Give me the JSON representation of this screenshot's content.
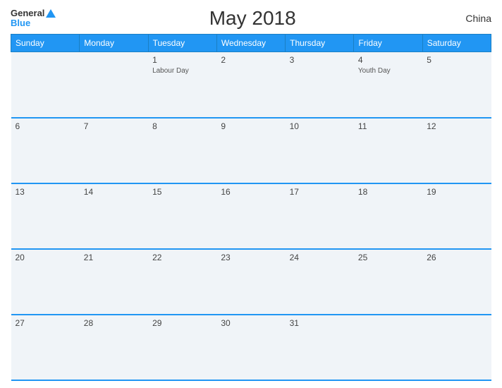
{
  "header": {
    "logo_general": "General",
    "logo_blue": "Blue",
    "title": "May 2018",
    "country": "China"
  },
  "calendar": {
    "days_of_week": [
      "Sunday",
      "Monday",
      "Tuesday",
      "Wednesday",
      "Thursday",
      "Friday",
      "Saturday"
    ],
    "weeks": [
      [
        {
          "day": "",
          "holiday": ""
        },
        {
          "day": "",
          "holiday": ""
        },
        {
          "day": "1",
          "holiday": "Labour Day"
        },
        {
          "day": "2",
          "holiday": ""
        },
        {
          "day": "3",
          "holiday": ""
        },
        {
          "day": "4",
          "holiday": "Youth Day"
        },
        {
          "day": "5",
          "holiday": ""
        }
      ],
      [
        {
          "day": "6",
          "holiday": ""
        },
        {
          "day": "7",
          "holiday": ""
        },
        {
          "day": "8",
          "holiday": ""
        },
        {
          "day": "9",
          "holiday": ""
        },
        {
          "day": "10",
          "holiday": ""
        },
        {
          "day": "11",
          "holiday": ""
        },
        {
          "day": "12",
          "holiday": ""
        }
      ],
      [
        {
          "day": "13",
          "holiday": ""
        },
        {
          "day": "14",
          "holiday": ""
        },
        {
          "day": "15",
          "holiday": ""
        },
        {
          "day": "16",
          "holiday": ""
        },
        {
          "day": "17",
          "holiday": ""
        },
        {
          "day": "18",
          "holiday": ""
        },
        {
          "day": "19",
          "holiday": ""
        }
      ],
      [
        {
          "day": "20",
          "holiday": ""
        },
        {
          "day": "21",
          "holiday": ""
        },
        {
          "day": "22",
          "holiday": ""
        },
        {
          "day": "23",
          "holiday": ""
        },
        {
          "day": "24",
          "holiday": ""
        },
        {
          "day": "25",
          "holiday": ""
        },
        {
          "day": "26",
          "holiday": ""
        }
      ],
      [
        {
          "day": "27",
          "holiday": ""
        },
        {
          "day": "28",
          "holiday": ""
        },
        {
          "day": "29",
          "holiday": ""
        },
        {
          "day": "30",
          "holiday": ""
        },
        {
          "day": "31",
          "holiday": ""
        },
        {
          "day": "",
          "holiday": ""
        },
        {
          "day": "",
          "holiday": ""
        }
      ]
    ]
  }
}
